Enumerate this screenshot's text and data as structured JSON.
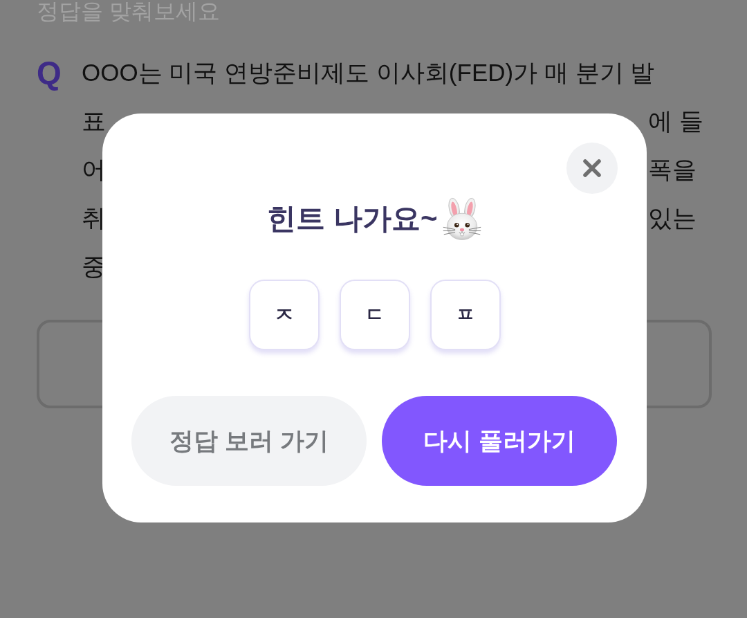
{
  "page": {
    "instruction": "정답을 맞춰보세요",
    "question": {
      "marker": "Q",
      "lines": [
        {
          "left": "OOO는 미국 연방준비제도 이사회(FED)가 매 분기 발"
        },
        {
          "left": "표",
          "right": "에 들"
        },
        {
          "left": "어",
          "right": "폭을"
        },
        {
          "left": "취",
          "right": "있는"
        },
        {
          "left": "중"
        }
      ]
    }
  },
  "hint_dialog": {
    "title": "힌트 나가요~",
    "hints": [
      "ㅈ",
      "ㄷ",
      "ㅍ"
    ],
    "buttons": [
      {
        "label": "정답 보러 가기",
        "kind": "secondary"
      },
      {
        "label": "다시 풀러가기",
        "kind": "primary"
      }
    ]
  }
}
